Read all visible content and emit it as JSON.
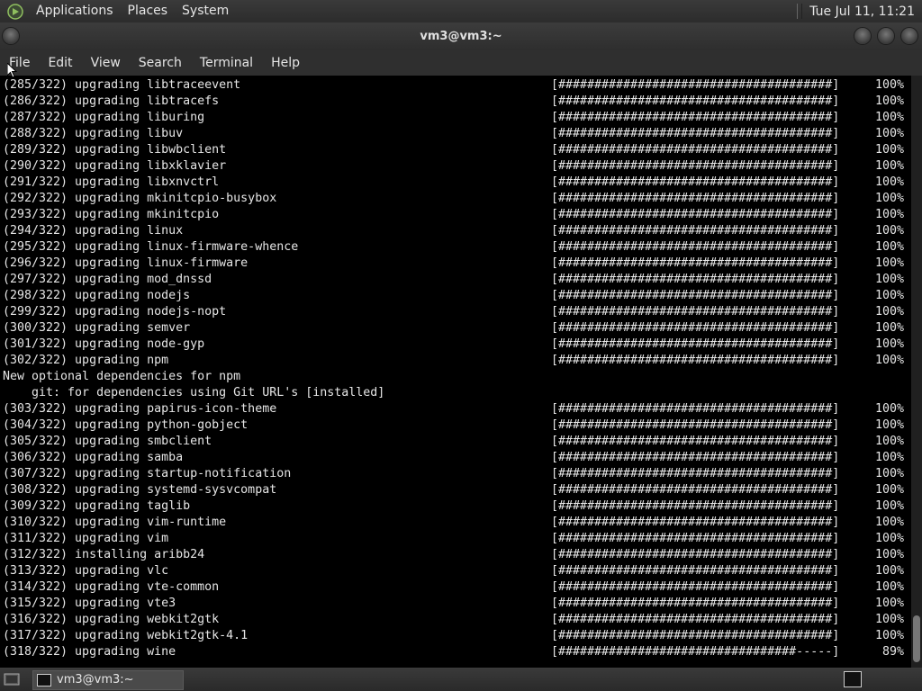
{
  "top_panel": {
    "menus": [
      "Applications",
      "Places",
      "System"
    ],
    "clock": "Tue Jul 11, 11:21"
  },
  "window": {
    "title": "vm3@vm3:~"
  },
  "menubar": [
    "File",
    "Edit",
    "View",
    "Search",
    "Terminal",
    "Help"
  ],
  "terminal": {
    "lines": [
      {
        "text": "(285/322) upgrading libtraceevent",
        "bar": "[######################################]",
        "pct": "100%"
      },
      {
        "text": "(286/322) upgrading libtracefs",
        "bar": "[######################################]",
        "pct": "100%"
      },
      {
        "text": "(287/322) upgrading liburing",
        "bar": "[######################################]",
        "pct": "100%"
      },
      {
        "text": "(288/322) upgrading libuv",
        "bar": "[######################################]",
        "pct": "100%"
      },
      {
        "text": "(289/322) upgrading libwbclient",
        "bar": "[######################################]",
        "pct": "100%"
      },
      {
        "text": "(290/322) upgrading libxklavier",
        "bar": "[######################################]",
        "pct": "100%"
      },
      {
        "text": "(291/322) upgrading libxnvctrl",
        "bar": "[######################################]",
        "pct": "100%"
      },
      {
        "text": "(292/322) upgrading mkinitcpio-busybox",
        "bar": "[######################################]",
        "pct": "100%"
      },
      {
        "text": "(293/322) upgrading mkinitcpio",
        "bar": "[######################################]",
        "pct": "100%"
      },
      {
        "text": "(294/322) upgrading linux",
        "bar": "[######################################]",
        "pct": "100%"
      },
      {
        "text": "(295/322) upgrading linux-firmware-whence",
        "bar": "[######################################]",
        "pct": "100%"
      },
      {
        "text": "(296/322) upgrading linux-firmware",
        "bar": "[######################################]",
        "pct": "100%"
      },
      {
        "text": "(297/322) upgrading mod_dnssd",
        "bar": "[######################################]",
        "pct": "100%"
      },
      {
        "text": "(298/322) upgrading nodejs",
        "bar": "[######################################]",
        "pct": "100%"
      },
      {
        "text": "(299/322) upgrading nodejs-nopt",
        "bar": "[######################################]",
        "pct": "100%"
      },
      {
        "text": "(300/322) upgrading semver",
        "bar": "[######################################]",
        "pct": "100%"
      },
      {
        "text": "(301/322) upgrading node-gyp",
        "bar": "[######################################]",
        "pct": "100%"
      },
      {
        "text": "(302/322) upgrading npm",
        "bar": "[######################################]",
        "pct": "100%"
      },
      {
        "text": "New optional dependencies for npm",
        "bar": "",
        "pct": ""
      },
      {
        "text": "    git: for dependencies using Git URL's [installed]",
        "bar": "",
        "pct": ""
      },
      {
        "text": "(303/322) upgrading papirus-icon-theme",
        "bar": "[######################################]",
        "pct": "100%"
      },
      {
        "text": "(304/322) upgrading python-gobject",
        "bar": "[######################################]",
        "pct": "100%"
      },
      {
        "text": "(305/322) upgrading smbclient",
        "bar": "[######################################]",
        "pct": "100%"
      },
      {
        "text": "(306/322) upgrading samba",
        "bar": "[######################################]",
        "pct": "100%"
      },
      {
        "text": "(307/322) upgrading startup-notification",
        "bar": "[######################################]",
        "pct": "100%"
      },
      {
        "text": "(308/322) upgrading systemd-sysvcompat",
        "bar": "[######################################]",
        "pct": "100%"
      },
      {
        "text": "(309/322) upgrading taglib",
        "bar": "[######################################]",
        "pct": "100%"
      },
      {
        "text": "(310/322) upgrading vim-runtime",
        "bar": "[######################################]",
        "pct": "100%"
      },
      {
        "text": "(311/322) upgrading vim",
        "bar": "[######################################]",
        "pct": "100%"
      },
      {
        "text": "(312/322) installing aribb24",
        "bar": "[######################################]",
        "pct": "100%"
      },
      {
        "text": "(313/322) upgrading vlc",
        "bar": "[######################################]",
        "pct": "100%"
      },
      {
        "text": "(314/322) upgrading vte-common",
        "bar": "[######################################]",
        "pct": "100%"
      },
      {
        "text": "(315/322) upgrading vte3",
        "bar": "[######################################]",
        "pct": "100%"
      },
      {
        "text": "(316/322) upgrading webkit2gtk",
        "bar": "[######################################]",
        "pct": "100%"
      },
      {
        "text": "(317/322) upgrading webkit2gtk-4.1",
        "bar": "[######################################]",
        "pct": "100%"
      },
      {
        "text": "(318/322) upgrading wine",
        "bar": "[#################################-----]",
        "pct": "89%"
      }
    ]
  },
  "taskbar": {
    "task_label": "vm3@vm3:~"
  }
}
